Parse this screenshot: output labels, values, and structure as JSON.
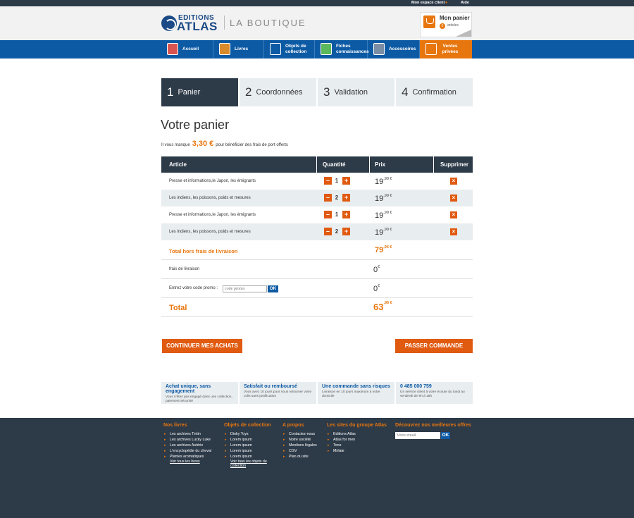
{
  "topbar": {
    "account": "Mon espace client",
    "help": "Aide"
  },
  "header": {
    "logo_line1": "EDITIONS",
    "logo_line2": "ATLAS",
    "boutique": "LA BOUTIQUE",
    "cart_title": "Mon panier",
    "cart_count": "0",
    "cart_articles": "articles"
  },
  "nav": [
    {
      "label": "Accueil",
      "icon": "home-icon",
      "color": "#d9534f"
    },
    {
      "label": "Livres",
      "icon": "book-icon",
      "color": "#d98a2b"
    },
    {
      "label": "Objets de collection",
      "icon": "car-icon",
      "color": "#ffffff"
    },
    {
      "label": "Fiches connaissances",
      "icon": "cards-icon",
      "color": "#5cb85c"
    },
    {
      "label": "Accessoires",
      "icon": "accessory-icon",
      "color": "#7a8fa6"
    },
    {
      "label": "Ventes privées",
      "icon": "ribbon-icon",
      "color": "#ffffff"
    }
  ],
  "steps": [
    {
      "num": "1",
      "label": "Panier",
      "active": true
    },
    {
      "num": "2",
      "label": "Coordonnées",
      "active": false
    },
    {
      "num": "3",
      "label": "Validation",
      "active": false
    },
    {
      "num": "4",
      "label": "Confirmation",
      "active": false
    }
  ],
  "page_title": "Votre panier",
  "notice": {
    "before": "Il vous manque",
    "amount": "3,30 €",
    "after": "pour bénéficier des frais de port offerts"
  },
  "table": {
    "headers": {
      "article": "Article",
      "quantity": "Quantité",
      "price": "Prix",
      "delete": "Supprimer"
    },
    "rows": [
      {
        "article": "Presse et informations,le Japon,  les émigrants",
        "qty": "1",
        "price_int": "19",
        "price_dec": ",99 €"
      },
      {
        "article": "Les indiens, les poissons, poids et mesures",
        "qty": "2",
        "price_int": "19",
        "price_dec": ",99 €"
      },
      {
        "article": "Presse et informations,le Japon,  les émigrants",
        "qty": "1",
        "price_int": "19",
        "price_dec": ",99 €"
      },
      {
        "article": "Les indiens, les poissons, poids et mesures",
        "qty": "2",
        "price_int": "19",
        "price_dec": ",99 €"
      }
    ],
    "minus": "–",
    "plus": "+",
    "delete_symbol": "×"
  },
  "summary": {
    "subtotal_label": "Total hors frais de livraison",
    "subtotal_int": "79",
    "subtotal_dec": ",96 €",
    "shipping_label": "frais de livraison",
    "shipping_int": "0",
    "shipping_dec": "€",
    "promo_label": "Entrez votre code promo :",
    "promo_placeholder": "code promo",
    "promo_ok": "OK",
    "promo_int": "0",
    "promo_dec": "€",
    "total_label": "Total",
    "total_int": "63",
    "total_dec": ",96 €"
  },
  "buttons": {
    "continue": "CONTINUER MES ACHATS",
    "checkout": "PASSER COMMANDE"
  },
  "reassurance": [
    {
      "title": "Achat unique, sans engagement",
      "desc": "Vous n'êtes pas engagé dans une collection, paiement sécurisé"
    },
    {
      "title": "Satisfait ou remboursé",
      "desc": "Vous avez 10 jours pour nous retourner votre colis sans justification"
    },
    {
      "title": "Une commande sans risques",
      "desc": "Livraison en 10 jours maximum à votre domicile"
    },
    {
      "title": "0 485 000 759",
      "desc": "Un service client à votre écoute du lundi au vendredi de 9h à 18h"
    }
  ],
  "footer": {
    "livres": {
      "title": "Nos livres",
      "items": [
        "Les archives Tintin",
        "Les archives Lucky Luke",
        "Les archives Astérix",
        "L'encyclopédie du cheval",
        "Plantes aromatiques"
      ],
      "more": "Voir tous les livres"
    },
    "objets": {
      "title": "Objets de collection",
      "items": [
        "Dinky Toys",
        "Lorem ipsum",
        "Lorem ipsum",
        "Lorem ipsum",
        "Lorem ipsum"
      ],
      "more": "Voir tous les  objets de collection"
    },
    "apropos": {
      "title": "A propos",
      "items": [
        "Contactez-nous",
        "Notre société",
        "Mentions légales",
        "CGV",
        "Plan du site"
      ]
    },
    "sites": {
      "title": "Les sites du groupe Atlas",
      "items": [
        "Editions Atlas",
        "Atlas for men",
        "Tono",
        "Mirlaie"
      ]
    },
    "newsletter": {
      "title": "Découvrez nos meilleures offres",
      "placeholder": "Votre email",
      "ok": "OK"
    }
  },
  "colors": {
    "navy": "#2d3a48",
    "blue": "#0d5aa4",
    "orange": "#e8760e",
    "light": "#e8edf0"
  }
}
